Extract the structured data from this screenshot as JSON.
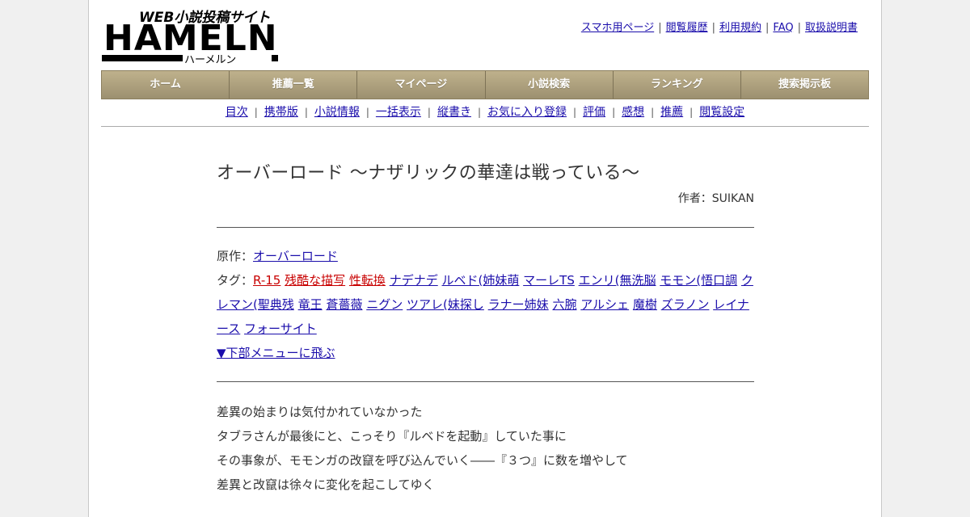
{
  "logo": {
    "main": "HAMELN",
    "tagline": "WEB小説投稿サイト",
    "kana": "ハーメルン"
  },
  "top_links": [
    "スマホ用ページ",
    "閲覧履歴",
    "利用規約",
    "FAQ",
    "取扱説明書"
  ],
  "global_nav": [
    "ホーム",
    "推薦一覧",
    "マイページ",
    "小説検索",
    "ランキング",
    "捜索掲示板"
  ],
  "sub_nav": [
    "目次",
    "携帯版",
    "小説情報",
    "一括表示",
    "縦書き",
    "お気に入り登録",
    "評価",
    "感想",
    "推薦",
    "閲覧設定"
  ],
  "novel": {
    "title": "オーバーロード ～ナザリックの華達は戦っている～",
    "author_label": "作者：",
    "author": "SUIKAN",
    "original_label": "原作：",
    "original": "オーバーロード",
    "tags_label": "タグ：",
    "tags_red": [
      "R-15",
      "残酷な描写",
      "性転換"
    ],
    "tags": [
      "ナデナデ",
      "ルベド(姉妹萌",
      "マーレTS",
      "エンリ(無洗脳",
      "モモン(悟口調",
      "クレマン(聖典残",
      "竜王",
      "蒼薔薇",
      "ニグン",
      "ツアレ(妹探し",
      "ラナー姉妹",
      "六腕",
      "アルシェ",
      "魔樹",
      "ズラノン",
      "レイナース",
      "フォーサイト"
    ],
    "jump_link": "▼下部メニューに飛ぶ",
    "body": [
      "差異の始まりは気付かれていなかった",
      "タブラさんが最後にと、こっそり『ルベドを起動』していた事に",
      "その事象が、モモンガの改竄を呼び込んでいく――『３つ』に数を増やして",
      "差異と改竄は徐々に変化を起こしてゆく"
    ]
  },
  "colors": {
    "nav_top": "#bfb18c",
    "nav_bottom": "#9c9070",
    "link": "#1a0dab",
    "red_tag": "#c80000"
  }
}
